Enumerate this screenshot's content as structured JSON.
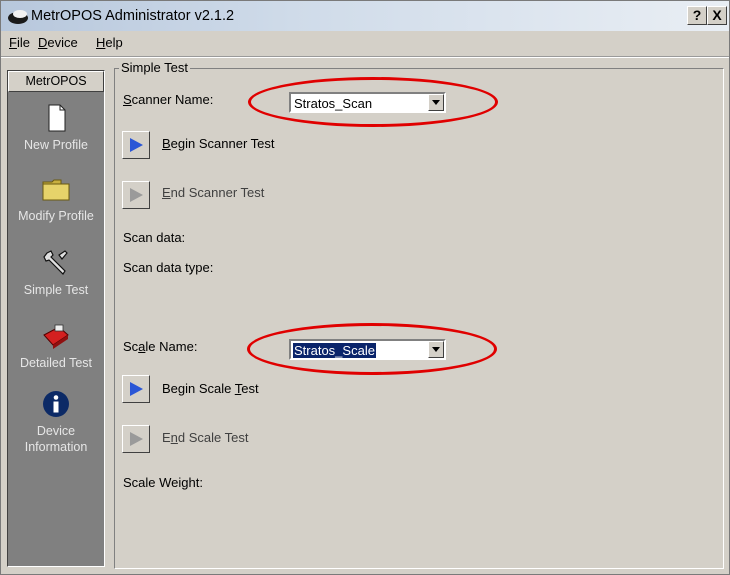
{
  "window": {
    "title": "MetrOPOS Administrator v2.1.2",
    "help_btn": "?",
    "close_btn": "X"
  },
  "menu": [
    {
      "label": "File",
      "mnemonic": "F",
      "rest": "ile"
    },
    {
      "label": "Device",
      "mnemonic": "D",
      "rest": "evice"
    },
    {
      "label": "Help",
      "mnemonic": "H",
      "rest": "elp"
    }
  ],
  "sidebar": {
    "header": "MetrOPOS",
    "items": [
      {
        "label": "New Profile",
        "icon": "document-icon"
      },
      {
        "label": "Modify Profile",
        "icon": "folder-icon"
      },
      {
        "label": "Simple Test",
        "icon": "wrench-icon"
      },
      {
        "label": "Detailed Test",
        "icon": "toolbox-icon"
      },
      {
        "label_line1": "Device",
        "label_line2": "Information",
        "icon": "info-icon"
      }
    ]
  },
  "group": {
    "title": "Simple Test",
    "scanner_label_m": "S",
    "scanner_label_rest": "canner Name:",
    "scanner_value": "Stratos_Scan",
    "begin_scanner_m": "B",
    "begin_scanner_rest": "egin Scanner Test",
    "end_scanner_m": "E",
    "end_scanner_rest": "nd Scanner Test",
    "scan_data": "Scan data:",
    "scan_data_type": "Scan data type:",
    "scale_label_a": "Sc",
    "scale_label_m": "a",
    "scale_label_rest": "le Name:",
    "scale_value": "Stratos_Scale",
    "begin_scale_a": "Begin Scale ",
    "begin_scale_m": "T",
    "begin_scale_rest": "est",
    "end_scale_a": "E",
    "end_scale_m": "n",
    "end_scale_rest": "d Scale Test",
    "scale_weight": "Scale Weight:"
  },
  "colors": {
    "highlight": "#e00000",
    "selection": "#0a246a",
    "play": "#2a56d6"
  }
}
